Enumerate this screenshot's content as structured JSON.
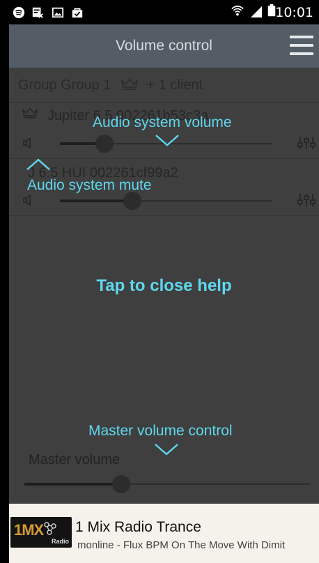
{
  "status_bar": {
    "time": "10:01",
    "icons_left": [
      "spotify-icon",
      "tv-icon",
      "image-icon",
      "bag-icon"
    ],
    "icons_right": [
      "wifi-icon",
      "signal-icon",
      "battery-icon"
    ]
  },
  "app_bar": {
    "title": "Volume control",
    "menu_icon": "hamburger-menu-icon"
  },
  "group": {
    "label": "Group Group 1",
    "crown_icon": "crown-icon",
    "clients_text": "+ 1 client"
  },
  "clients": [
    {
      "name": "Jupiter 6.5 002261b53c3a",
      "volume": 0.21
    },
    {
      "name": "J 6.5 HUI 002261cf99a2",
      "volume": 0.34
    }
  ],
  "master": {
    "label": "Master volume",
    "volume": 0.34
  },
  "help_overlay": {
    "audio_system_volume": "Audio system volume",
    "audio_system_mute": "Audio system mute",
    "tap_to_close": "Tap to close help",
    "master_volume_control": "Master volume control",
    "accent_color": "#5fd7ee"
  },
  "now_playing": {
    "logo_text": "1MX",
    "logo_sub": "Radio",
    "station": "1 Mix Radio Trance",
    "track": "monline - Flux BPM On The Move With Dimit"
  }
}
